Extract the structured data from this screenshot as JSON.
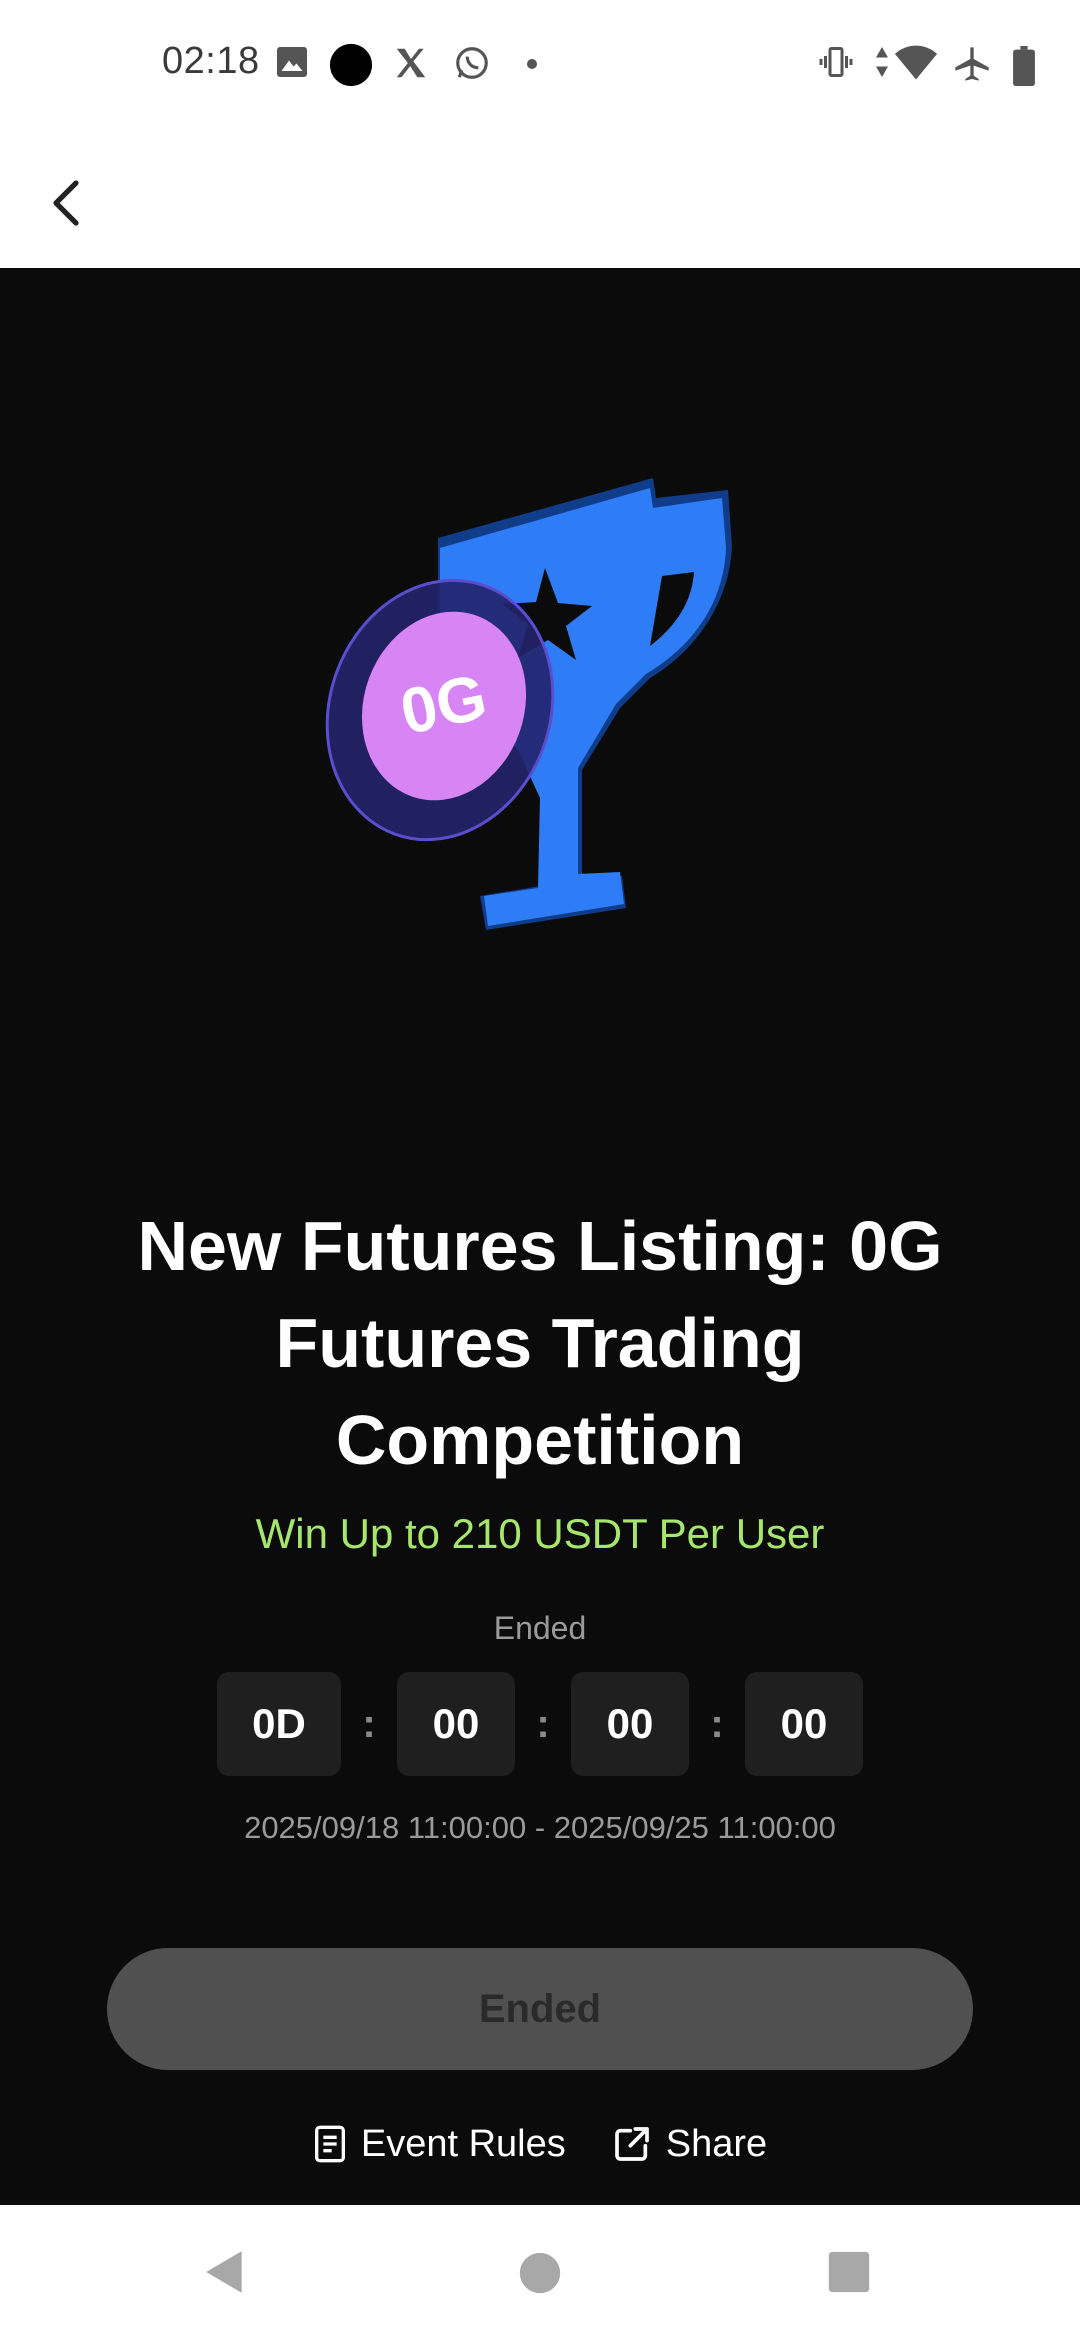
{
  "status_bar": {
    "time": "02:18",
    "left_icons": [
      "image-icon",
      "app-circle-icon",
      "x-icon",
      "whatsapp-icon",
      "dot-icon"
    ],
    "right_icons": [
      "vibrate-icon",
      "data-arrows-icon",
      "wifi-icon",
      "airplane-icon",
      "battery-icon"
    ]
  },
  "app_bar": {
    "back_icon": "chevron-left-icon"
  },
  "event": {
    "title": "New Futures Listing: 0G Futures Trading Competition",
    "coin_label": "0G",
    "subtitle": "Win Up to 210 USDT Per User",
    "status_label": "Ended",
    "countdown": {
      "days": "0D",
      "hours": "00",
      "minutes": "00",
      "seconds": "00",
      "separator": ":"
    },
    "date_range": "2025/09/18 11:00:00 - 2025/09/25 11:00:00",
    "cta_label": "Ended",
    "links": {
      "rules_label": "Event Rules",
      "share_label": "Share"
    }
  },
  "nav_bar": {
    "icons": [
      "back-triangle-icon",
      "home-circle-icon",
      "recents-square-icon"
    ]
  },
  "colors": {
    "background_dark": "#0b0b0b",
    "accent_green": "#a6e66f",
    "trophy_blue": "#2f7df6",
    "coin_purple": "#d784f5",
    "disabled_button": "#505050"
  }
}
